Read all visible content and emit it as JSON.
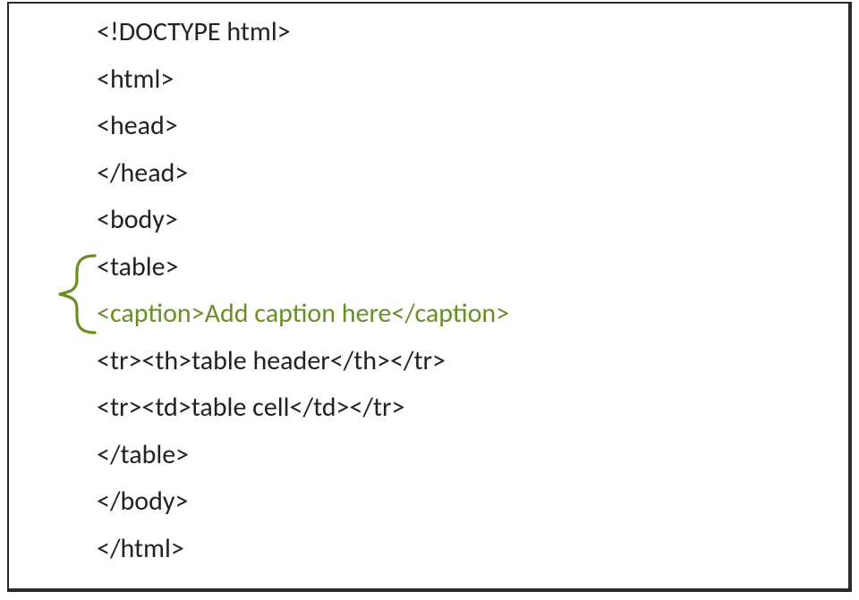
{
  "code": {
    "lines": [
      "<!DOCTYPE html>",
      "<html>",
      "<head>",
      "</head>",
      "<body>",
      "<table>",
      "<caption>Add caption here</caption>",
      "<tr><th>table header</th></tr>",
      "<tr><td>table cell</td></tr>",
      "</table>",
      "</body>",
      "</html>"
    ],
    "highlight_index": 6
  },
  "colors": {
    "highlight": "#6b8e23",
    "text": "#222222",
    "border": "#2a2a2a"
  }
}
